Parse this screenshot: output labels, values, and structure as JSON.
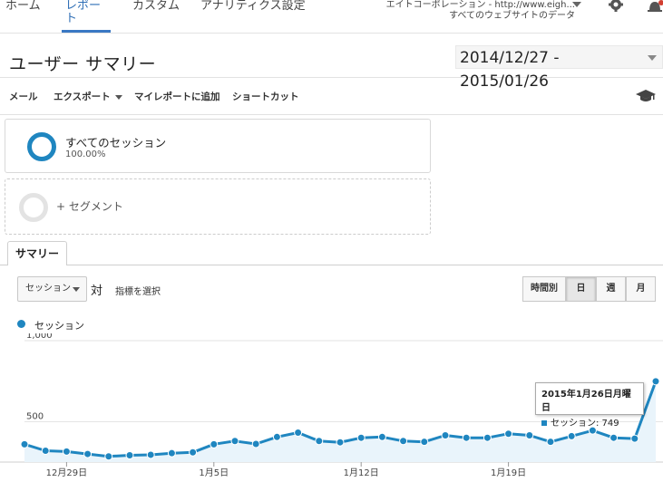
{
  "nav": {
    "tabs": [
      {
        "label": "ホーム"
      },
      {
        "label": "レポート"
      },
      {
        "label": "カスタム"
      },
      {
        "label": "アナリティクス設定"
      }
    ],
    "account_name": "エイトコーポレーション - http://www.eigh...",
    "account_view": "すべてのウェブサイトのデータ"
  },
  "header": {
    "title": "ユーザー サマリー",
    "date_range": "2014/12/27 - 2015/01/26"
  },
  "toolbar": {
    "email": "メール",
    "export": "エクスポート",
    "add_to_dashboard": "マイレポートに追加",
    "shortcut": "ショートカット"
  },
  "segments": {
    "active_name": "すべてのセッション",
    "active_pct": "100.00%",
    "add_label": "+ セグメント"
  },
  "summary": {
    "tab_label": "サマリー",
    "metric": "セッション",
    "vs": "対",
    "select_metric": "指標を選択",
    "granularity": [
      "時間別",
      "日",
      "週",
      "月"
    ],
    "granularity_active": "日"
  },
  "legend": {
    "label": "セッション"
  },
  "tooltip": {
    "date": "2015年1月26日月曜日",
    "metric_label": "セッション: 749"
  },
  "colors": {
    "line": "#1f86c0",
    "fill": "#e9f4fb",
    "accent": "#3a78c3"
  },
  "chart_data": {
    "type": "area",
    "x": [
      "2014-12-27",
      "2014-12-28",
      "2014-12-29",
      "2014-12-30",
      "2014-12-31",
      "2015-01-01",
      "2015-01-02",
      "2015-01-03",
      "2015-01-04",
      "2015-01-05",
      "2015-01-06",
      "2015-01-07",
      "2015-01-08",
      "2015-01-09",
      "2015-01-10",
      "2015-01-11",
      "2015-01-12",
      "2015-01-13",
      "2015-01-14",
      "2015-01-15",
      "2015-01-16",
      "2015-01-17",
      "2015-01-18",
      "2015-01-19",
      "2015-01-20",
      "2015-01-21",
      "2015-01-22",
      "2015-01-23",
      "2015-01-24",
      "2015-01-25",
      "2015-01-26"
    ],
    "series": [
      {
        "name": "セッション",
        "values": [
          360,
          320,
          315,
          300,
          285,
          292,
          295,
          305,
          310,
          360,
          380,
          362,
          405,
          432,
          380,
          372,
          400,
          405,
          380,
          375,
          415,
          400,
          400,
          425,
          415,
          375,
          410,
          445,
          400,
          395,
          749
        ]
      }
    ],
    "ylim": [
      250,
      1000
    ],
    "yticks": [
      {
        "value": 1000,
        "label": "1,000"
      },
      {
        "value": 500,
        "label": "500"
      }
    ],
    "xticks": [
      {
        "index": 2,
        "label": "12月29日"
      },
      {
        "index": 9,
        "label": "1月5日"
      },
      {
        "index": 16,
        "label": "1月12日"
      },
      {
        "index": 23,
        "label": "1月19日"
      }
    ],
    "grid": true,
    "legend": "top-left"
  }
}
